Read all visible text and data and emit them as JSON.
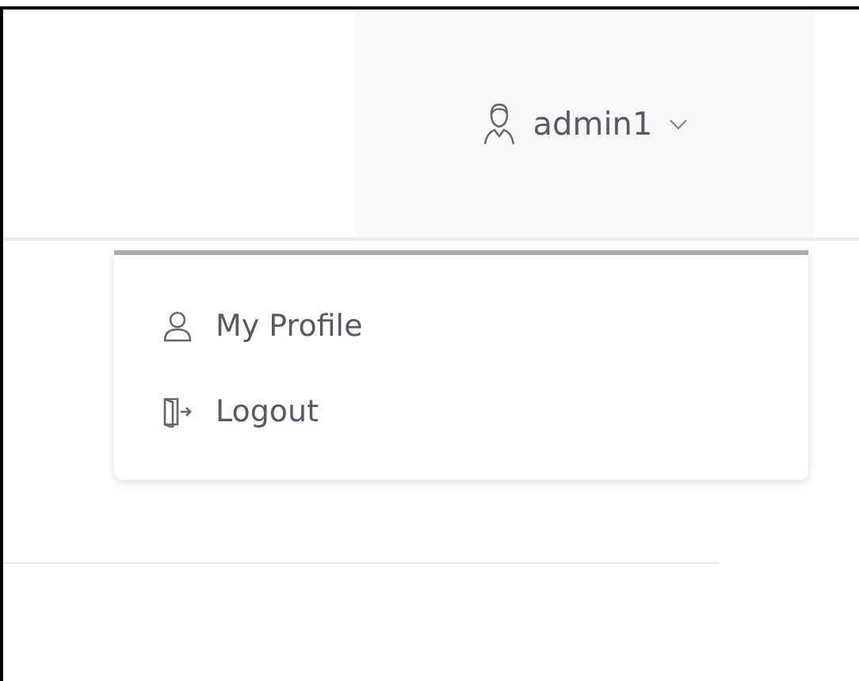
{
  "user": {
    "name": "admin1"
  },
  "menu": [
    {
      "label": "My Profile",
      "kind": "profile"
    },
    {
      "label": "Logout",
      "kind": "logout"
    }
  ]
}
